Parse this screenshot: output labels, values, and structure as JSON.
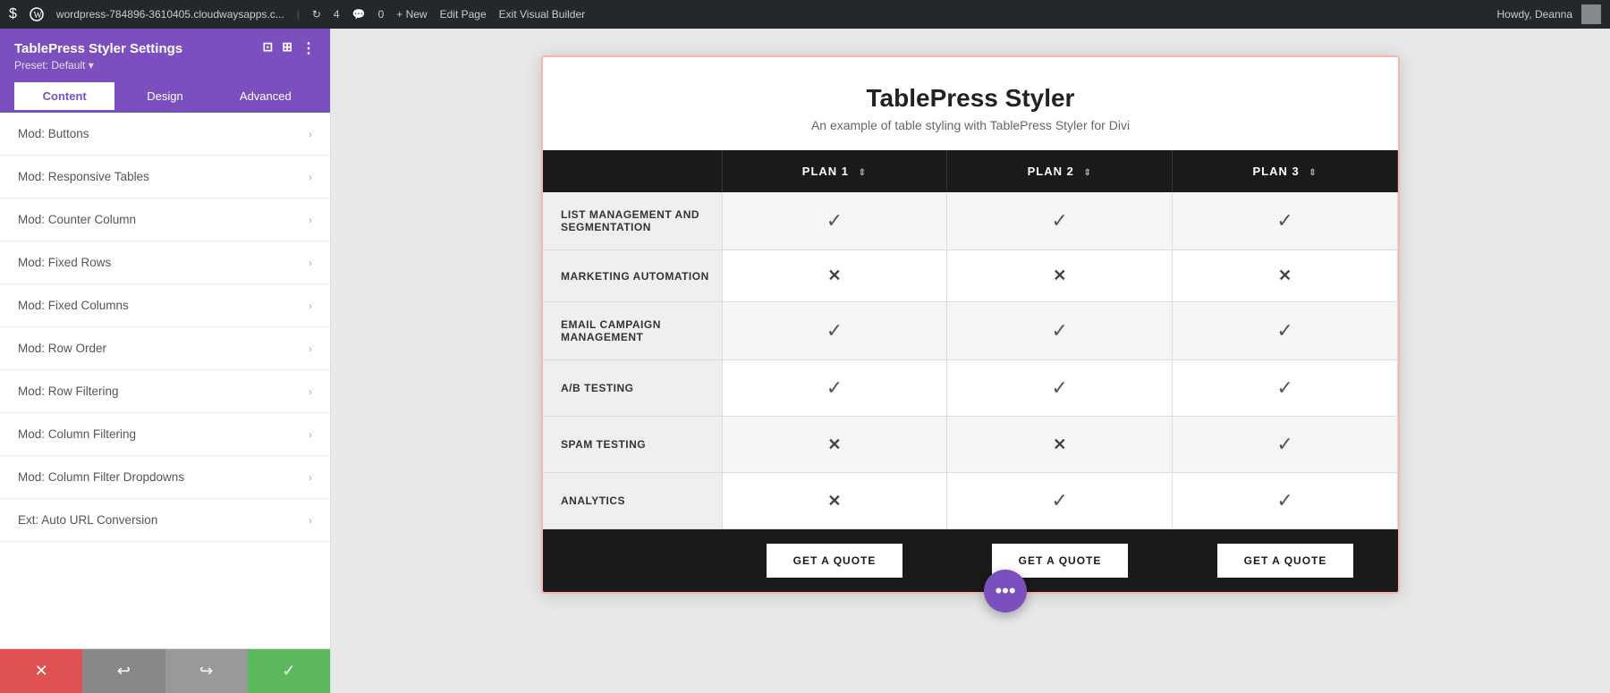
{
  "topbar": {
    "wp_logo": "W",
    "site_link": "wordpress-784896-3610405.cloudwaysapps.c...",
    "refresh_count": "4",
    "comment_count": "0",
    "new_label": "+ New",
    "edit_page_label": "Edit Page",
    "exit_vb_label": "Exit Visual Builder",
    "howdy_label": "Howdy, Deanna"
  },
  "sidebar": {
    "title": "TablePress Styler Settings",
    "icon_minimize": "⊡",
    "icon_split": "⊞",
    "icon_more": "⋮",
    "preset_label": "Preset: Default",
    "tabs": [
      {
        "id": "content",
        "label": "Content",
        "active": true
      },
      {
        "id": "design",
        "label": "Design",
        "active": false
      },
      {
        "id": "advanced",
        "label": "Advanced",
        "active": false
      }
    ],
    "items": [
      {
        "id": "mod-buttons",
        "label": "Mod: Buttons"
      },
      {
        "id": "mod-responsive-tables",
        "label": "Mod: Responsive Tables"
      },
      {
        "id": "mod-counter-column",
        "label": "Mod: Counter Column"
      },
      {
        "id": "mod-fixed-rows",
        "label": "Mod: Fixed Rows"
      },
      {
        "id": "mod-fixed-columns",
        "label": "Mod: Fixed Columns"
      },
      {
        "id": "mod-row-order",
        "label": "Mod: Row Order"
      },
      {
        "id": "mod-row-filtering",
        "label": "Mod: Row Filtering"
      },
      {
        "id": "mod-column-filtering",
        "label": "Mod: Column Filtering"
      },
      {
        "id": "mod-column-filter-dropdowns",
        "label": "Mod: Column Filter Dropdowns"
      },
      {
        "id": "ext-auto-url-conversion",
        "label": "Ext: Auto URL Conversion"
      }
    ],
    "bottom_buttons": [
      {
        "id": "cancel",
        "icon": "✕",
        "type": "red"
      },
      {
        "id": "undo",
        "icon": "↩",
        "type": "gray-dark"
      },
      {
        "id": "redo",
        "icon": "↪",
        "type": "gray-mid"
      },
      {
        "id": "save",
        "icon": "✓",
        "type": "green"
      }
    ]
  },
  "table": {
    "title": "TablePress Styler",
    "subtitle": "An example of table styling with TablePress Styler for Divi",
    "columns": [
      {
        "id": "feature",
        "label": ""
      },
      {
        "id": "plan1",
        "label": "PLAN 1"
      },
      {
        "id": "plan2",
        "label": "PLAN 2"
      },
      {
        "id": "plan3",
        "label": "PLAN 3"
      }
    ],
    "rows": [
      {
        "feature": "LIST MANAGEMENT AND SEGMENTATION",
        "plan1": "check",
        "plan2": "check",
        "plan3": "check"
      },
      {
        "feature": "MARKETING AUTOMATION",
        "plan1": "x",
        "plan2": "x",
        "plan3": "x"
      },
      {
        "feature": "EMAIL CAMPAIGN MANAGEMENT",
        "plan1": "check",
        "plan2": "check",
        "plan3": "check"
      },
      {
        "feature": "A/B TESTING",
        "plan1": "check",
        "plan2": "check",
        "plan3": "check"
      },
      {
        "feature": "SPAM TESTING",
        "plan1": "x",
        "plan2": "x",
        "plan3": "check"
      },
      {
        "feature": "ANALYTICS",
        "plan1": "x",
        "plan2": "check",
        "plan3": "check"
      }
    ],
    "footer_button_label": "GET A QUOTE"
  },
  "fab": {
    "icon": "⋯"
  }
}
